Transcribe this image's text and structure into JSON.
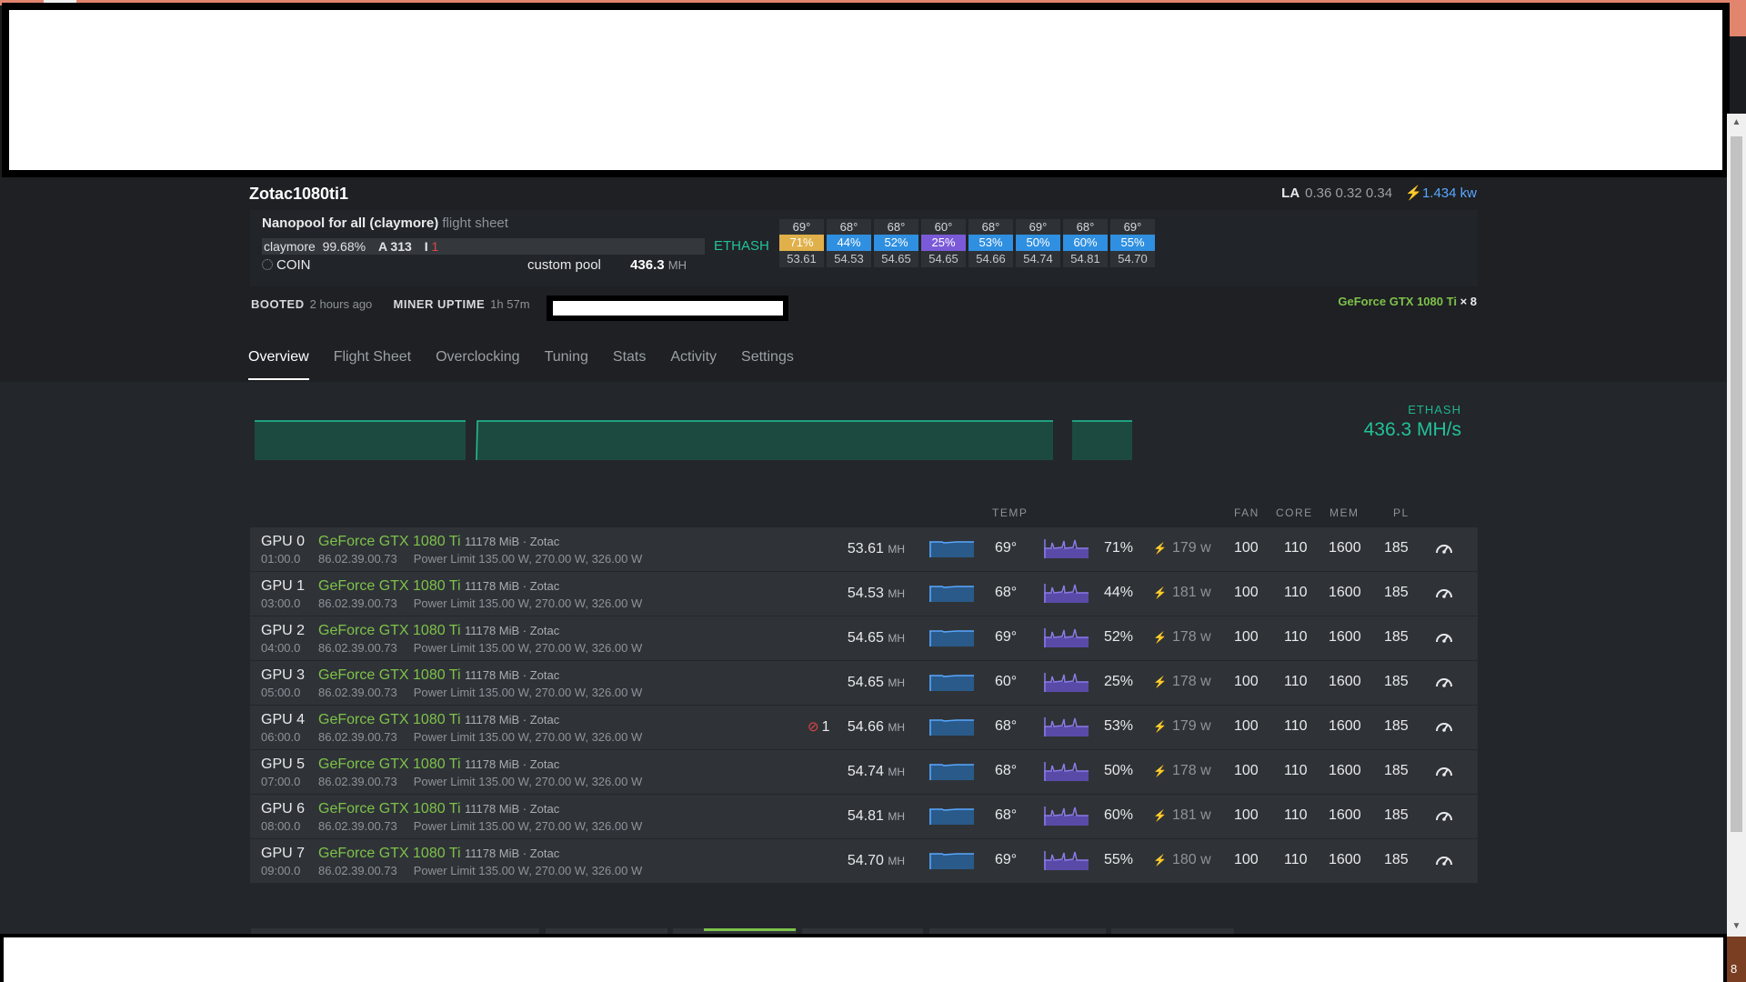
{
  "worker": {
    "name": "Zotac1080ti1",
    "la_label": "LA",
    "la_values": "0.36 0.32 0.34",
    "power": "1.434",
    "power_unit": "kw"
  },
  "flight_sheet": {
    "name": "Nanopool for all (claymore)",
    "suffix": "flight sheet",
    "miner": "claymore",
    "uptime_pct": "99.68%",
    "accepted": "A 313",
    "invalid_label": "I",
    "invalid": "1",
    "algo": "ETHASH",
    "coin": "COIN",
    "pool": "custom pool",
    "hashrate": "436.3",
    "hash_unit": "MH"
  },
  "tiles": [
    {
      "temp": "69°",
      "fan": "71%",
      "hash": "53.61",
      "color": "#e0b04a"
    },
    {
      "temp": "68°",
      "fan": "44%",
      "hash": "54.53",
      "color": "#2f8fe0"
    },
    {
      "temp": "68°",
      "fan": "52%",
      "hash": "54.65",
      "color": "#2f8fe0"
    },
    {
      "temp": "60°",
      "fan": "25%",
      "hash": "54.65",
      "color": "#7a5ad8"
    },
    {
      "temp": "68°",
      "fan": "53%",
      "hash": "54.66",
      "color": "#2f8fe0"
    },
    {
      "temp": "69°",
      "fan": "50%",
      "hash": "54.74",
      "color": "#2f8fe0"
    },
    {
      "temp": "68°",
      "fan": "60%",
      "hash": "54.81",
      "color": "#2f8fe0"
    },
    {
      "temp": "69°",
      "fan": "55%",
      "hash": "54.70",
      "color": "#2f8fe0"
    }
  ],
  "status": {
    "booted_label": "BOOTED",
    "booted_value": "2 hours ago",
    "miner_uptime_label": "MINER UPTIME",
    "miner_uptime_value": "1h 57m",
    "gpu_model": "GeForce GTX 1080 Ti",
    "gpu_count": "× 8"
  },
  "tabs": [
    "Overview",
    "Flight Sheet",
    "Overclocking",
    "Tuning",
    "Stats",
    "Activity",
    "Settings"
  ],
  "active_tab": "Overview",
  "sparkline": {
    "algo": "ETHASH",
    "rate": "436.3 MH/s"
  },
  "columns": {
    "temp": "TEMP",
    "fan": "FAN",
    "core": "CORE",
    "mem": "MEM",
    "pl": "PL"
  },
  "gpus": [
    {
      "name": "GPU 0",
      "bus": "01:00.0",
      "model": "GeForce GTX 1080 Ti",
      "mem": "11178 MiB · Zotac",
      "bios": "86.02.39.00.73",
      "power_limit": "Power Limit 135.00 W, 270.00 W, 326.00 W",
      "invalid": "",
      "hash": "53.61",
      "unit": "MH",
      "temp": "69°",
      "fan_pct": "71%",
      "power": "179 w",
      "fan": "100",
      "core": "110",
      "memclk": "1600",
      "pl": "185"
    },
    {
      "name": "GPU 1",
      "bus": "03:00.0",
      "model": "GeForce GTX 1080 Ti",
      "mem": "11178 MiB · Zotac",
      "bios": "86.02.39.00.73",
      "power_limit": "Power Limit 135.00 W, 270.00 W, 326.00 W",
      "invalid": "",
      "hash": "54.53",
      "unit": "MH",
      "temp": "68°",
      "fan_pct": "44%",
      "power": "181 w",
      "fan": "100",
      "core": "110",
      "memclk": "1600",
      "pl": "185"
    },
    {
      "name": "GPU 2",
      "bus": "04:00.0",
      "model": "GeForce GTX 1080 Ti",
      "mem": "11178 MiB · Zotac",
      "bios": "86.02.39.00.73",
      "power_limit": "Power Limit 135.00 W, 270.00 W, 326.00 W",
      "invalid": "",
      "hash": "54.65",
      "unit": "MH",
      "temp": "69°",
      "fan_pct": "52%",
      "power": "178 w",
      "fan": "100",
      "core": "110",
      "memclk": "1600",
      "pl": "185"
    },
    {
      "name": "GPU 3",
      "bus": "05:00.0",
      "model": "GeForce GTX 1080 Ti",
      "mem": "11178 MiB · Zotac",
      "bios": "86.02.39.00.73",
      "power_limit": "Power Limit 135.00 W, 270.00 W, 326.00 W",
      "invalid": "",
      "hash": "54.65",
      "unit": "MH",
      "temp": "60°",
      "fan_pct": "25%",
      "power": "178 w",
      "fan": "100",
      "core": "110",
      "memclk": "1600",
      "pl": "185"
    },
    {
      "name": "GPU 4",
      "bus": "06:00.0",
      "model": "GeForce GTX 1080 Ti",
      "mem": "11178 MiB · Zotac",
      "bios": "86.02.39.00.73",
      "power_limit": "Power Limit 135.00 W, 270.00 W, 326.00 W",
      "invalid": "1",
      "hash": "54.66",
      "unit": "MH",
      "temp": "68°",
      "fan_pct": "53%",
      "power": "179 w",
      "fan": "100",
      "core": "110",
      "memclk": "1600",
      "pl": "185"
    },
    {
      "name": "GPU 5",
      "bus": "07:00.0",
      "model": "GeForce GTX 1080 Ti",
      "mem": "11178 MiB · Zotac",
      "bios": "86.02.39.00.73",
      "power_limit": "Power Limit 135.00 W, 270.00 W, 326.00 W",
      "invalid": "",
      "hash": "54.74",
      "unit": "MH",
      "temp": "68°",
      "fan_pct": "50%",
      "power": "178 w",
      "fan": "100",
      "core": "110",
      "memclk": "1600",
      "pl": "185"
    },
    {
      "name": "GPU 6",
      "bus": "08:00.0",
      "model": "GeForce GTX 1080 Ti",
      "mem": "11178 MiB · Zotac",
      "bios": "86.02.39.00.73",
      "power_limit": "Power Limit 135.00 W, 270.00 W, 326.00 W",
      "invalid": "",
      "hash": "54.81",
      "unit": "MH",
      "temp": "68°",
      "fan_pct": "60%",
      "power": "181 w",
      "fan": "100",
      "core": "110",
      "memclk": "1600",
      "pl": "185"
    },
    {
      "name": "GPU 7",
      "bus": "09:00.0",
      "model": "GeForce GTX 1080 Ti",
      "mem": "11178 MiB · Zotac",
      "bios": "86.02.39.00.73",
      "power_limit": "Power Limit 135.00 W, 270.00 W, 326.00 W",
      "invalid": "",
      "hash": "54.70",
      "unit": "MH",
      "temp": "69°",
      "fan_pct": "55%",
      "power": "180 w",
      "fan": "100",
      "core": "110",
      "memclk": "1600",
      "pl": "185"
    }
  ],
  "icons": {
    "bolt": "bolt-icon",
    "oc": "gauge-icon",
    "invalid": "ban-icon",
    "loading": "spinner-icon"
  },
  "bottom_right_label": "8",
  "colors": {
    "accent_green": "#7ec24a",
    "algo_teal": "#21c29a",
    "power_blue": "#59a7ff",
    "danger": "#e04545"
  }
}
